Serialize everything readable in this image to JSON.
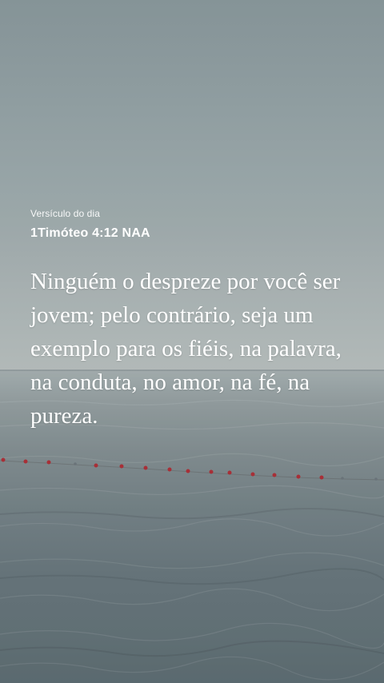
{
  "header": {
    "label": "Versículo do dia",
    "reference": "1Timóteo 4:12 NAA"
  },
  "verse": {
    "text": "Ninguém o despreze por você ser jovem; pelo contrário, seja um exemplo para os fiéis, na palavra, na conduta, no amor, na fé, na pureza."
  },
  "colors": {
    "text": "#ffffff",
    "buoy": "#b0323a"
  }
}
